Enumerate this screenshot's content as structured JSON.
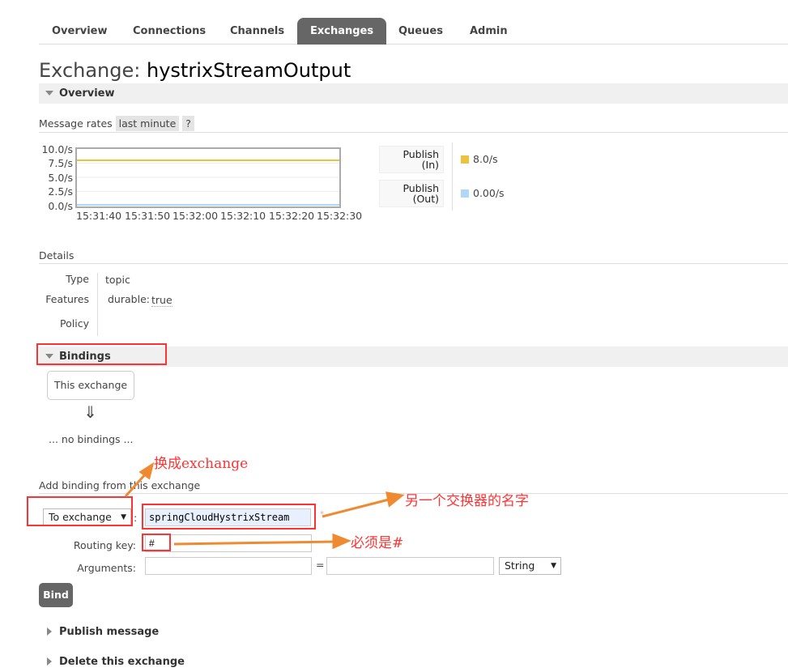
{
  "nav": {
    "tabs": [
      {
        "label": "Overview"
      },
      {
        "label": "Connections"
      },
      {
        "label": "Channels"
      },
      {
        "label": "Exchanges",
        "active": true
      },
      {
        "label": "Queues"
      },
      {
        "label": "Admin"
      }
    ]
  },
  "page": {
    "title_prefix": "Exchange:",
    "title_name": "hystrixStreamOutput"
  },
  "overview": {
    "label": "Overview",
    "rates_label": "Message rates",
    "range": "last minute",
    "help": "?"
  },
  "chart_data": {
    "type": "line",
    "y_ticks": [
      "10.0/s",
      "7.5/s",
      "5.0/s",
      "2.5/s",
      "0.0/s"
    ],
    "ylim": [
      0,
      10
    ],
    "x_ticks": [
      "15:31:40",
      "15:31:50",
      "15:32:00",
      "15:32:10",
      "15:32:20",
      "15:32:30"
    ],
    "series": [
      {
        "name": "Publish (In)",
        "value_label": "8.0/s",
        "color": "#edc240",
        "values": [
          8,
          8,
          8,
          8,
          8,
          8
        ]
      },
      {
        "name": "Publish (Out)",
        "value_label": "0.00/s",
        "color": "#afd8f8",
        "values": [
          0,
          0,
          0,
          0,
          0,
          0
        ]
      }
    ]
  },
  "legend": [
    {
      "line1": "Publish",
      "line2": "(In)",
      "value": "8.0/s"
    },
    {
      "line1": "Publish",
      "line2": "(Out)",
      "value": "0.00/s"
    }
  ],
  "details": {
    "label": "Details",
    "type_label": "Type",
    "type_value": "topic",
    "features_label": "Features",
    "feature_key": "durable:",
    "feature_value": "true",
    "policy_label": "Policy"
  },
  "bindings": {
    "label": "Bindings",
    "this_exchange": "This exchange",
    "arrow": "⇓",
    "none": "... no bindings ..."
  },
  "add_binding": {
    "label": "Add binding from this exchange",
    "dest_type": "To exchange",
    "dest_value": "springCloudHystrixStream",
    "required": "*",
    "routing_key_label": "Routing key:",
    "routing_key_value": "#",
    "arguments_label": "Arguments:",
    "equals": "=",
    "arg_type": "String",
    "bind_label": "Bind"
  },
  "sections": {
    "publish": "Publish message",
    "delete": "Delete this exchange"
  },
  "annotations": {
    "to_exchange": "换成exchange",
    "other_name": "另一个交换器的名字",
    "must_be": "必须是#"
  }
}
